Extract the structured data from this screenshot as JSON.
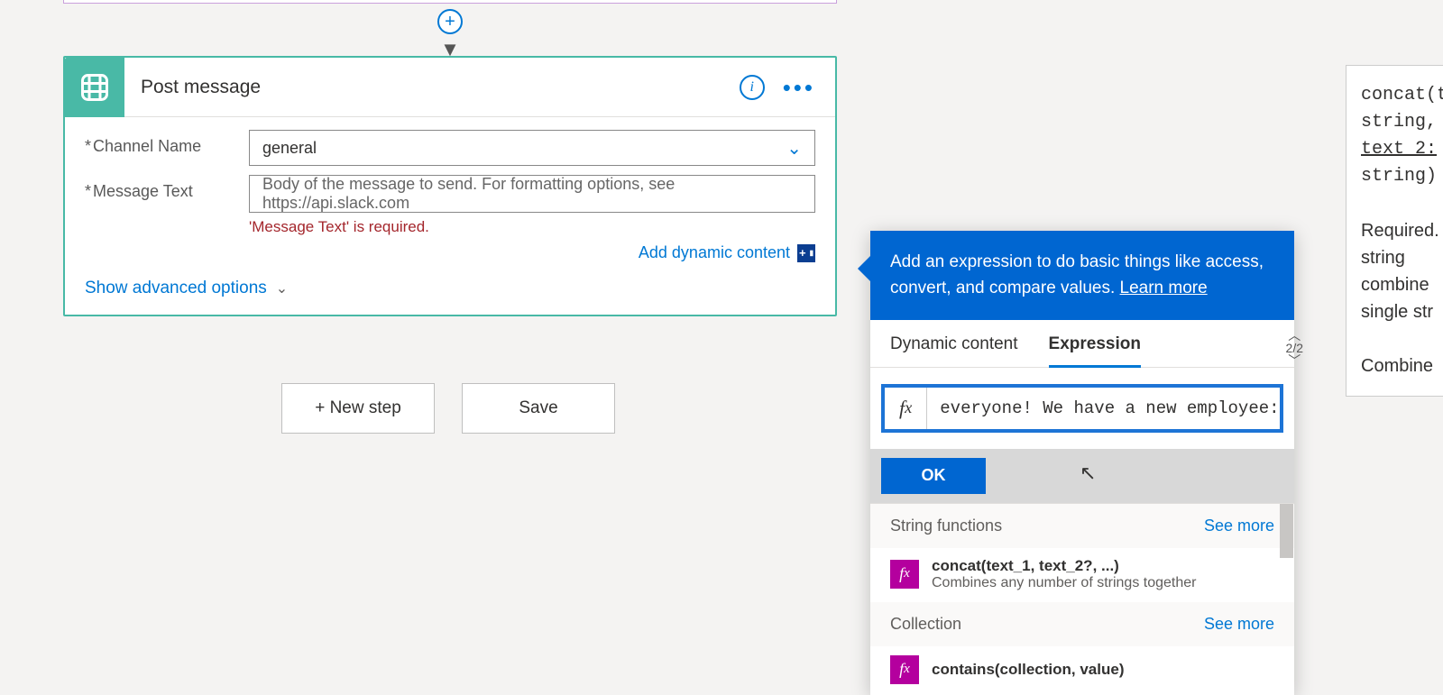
{
  "action_card": {
    "title": "Post message",
    "fields": {
      "channel": {
        "label": "Channel Name",
        "value": "general"
      },
      "message": {
        "label": "Message Text",
        "placeholder": "Body of the message to send. For formatting options, see https://api.slack.com",
        "error": "'Message Text' is required."
      }
    },
    "add_dynamic_label": "Add dynamic content",
    "show_advanced_label": "Show advanced options"
  },
  "buttons": {
    "new_step": "+ New step",
    "save": "Save"
  },
  "dc_panel": {
    "header_text": "Add an expression to do basic things like access, convert, and compare values. ",
    "learn_more": "Learn more",
    "tabs": {
      "dynamic": "Dynamic content",
      "expression": "Expression"
    },
    "pager": "2/2",
    "expression_value": "everyone! We have a new employee: ', )",
    "ok_label": "OK",
    "groups": [
      {
        "name": "String functions",
        "see_more": "See more",
        "items": [
          {
            "signature": "concat(text_1, text_2?, ...)",
            "description": "Combines any number of strings together"
          }
        ]
      },
      {
        "name": "Collection",
        "see_more": "See more",
        "items": [
          {
            "signature": "contains(collection, value)",
            "description": ""
          }
        ]
      }
    ]
  },
  "help_panel": {
    "line1": "concat(t",
    "line2": "string,",
    "line3": "text_2:",
    "line4": "string)",
    "req": "Required.",
    "desc1": "string",
    "desc2": "combine",
    "desc3": "single str",
    "combine": "Combine"
  }
}
